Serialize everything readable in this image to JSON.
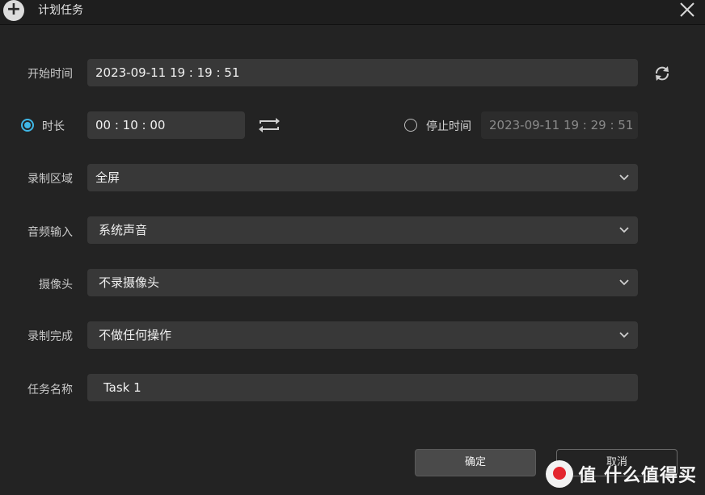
{
  "window": {
    "title": "计划任务"
  },
  "form": {
    "start_time": {
      "label": "开始时间",
      "value": "2023-09-11 19 : 19 : 51"
    },
    "duration": {
      "label": "时长",
      "value": "00 : 10 : 00",
      "selected": true
    },
    "stop_time": {
      "label": "停止时间",
      "value": "2023-09-11 19 : 29 : 51",
      "selected": false
    },
    "record_area": {
      "label": "录制区域",
      "value": "全屏"
    },
    "audio_input": {
      "label": "音频输入",
      "value": "系统声音"
    },
    "camera": {
      "label": "摄像头",
      "value": "不录摄像头"
    },
    "on_complete": {
      "label": "录制完成",
      "value": "不做任何操作"
    },
    "task_name": {
      "label": "任务名称",
      "value": "Task 1"
    }
  },
  "buttons": {
    "confirm": "确定",
    "cancel": "取消"
  },
  "watermark": {
    "text": "值 什么值得买"
  },
  "colors": {
    "accent": "#3fb7e6",
    "background": "#232323",
    "field": "#383838"
  }
}
